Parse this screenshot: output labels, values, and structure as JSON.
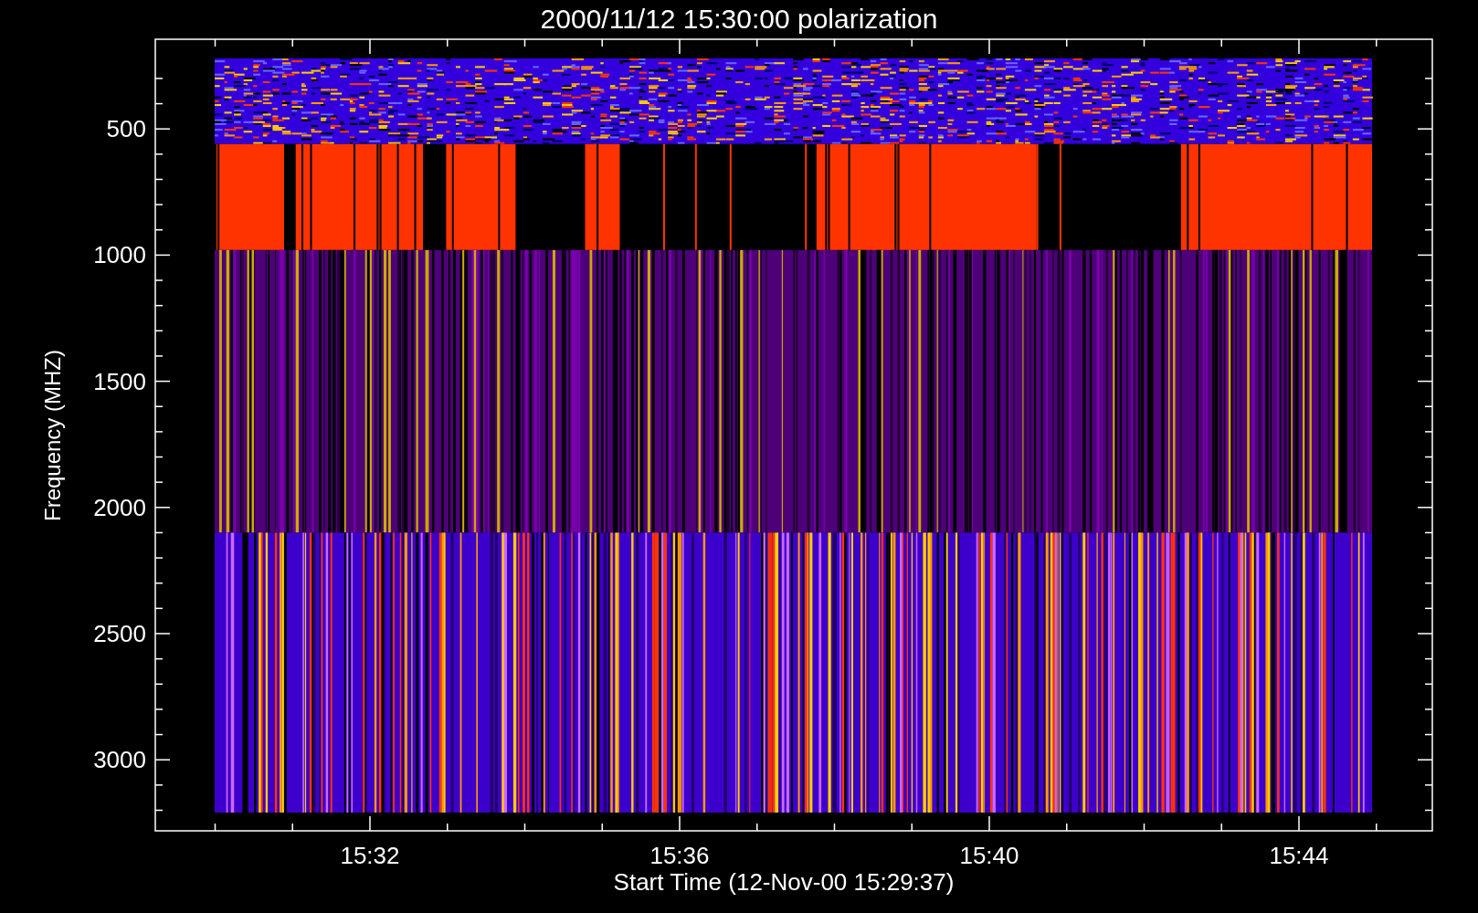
{
  "title": "2000/11/12 15:30:00 polarization",
  "y_axis": {
    "label": "Frequency (MHZ)",
    "ticks": [
      "500",
      "1000",
      "1500",
      "2000",
      "2500",
      "3000"
    ]
  },
  "x_axis": {
    "label": "Start Time (12-Nov-00 15:29:37)",
    "ticks": [
      "15:32",
      "15:36",
      "15:40",
      "15:44"
    ]
  }
}
